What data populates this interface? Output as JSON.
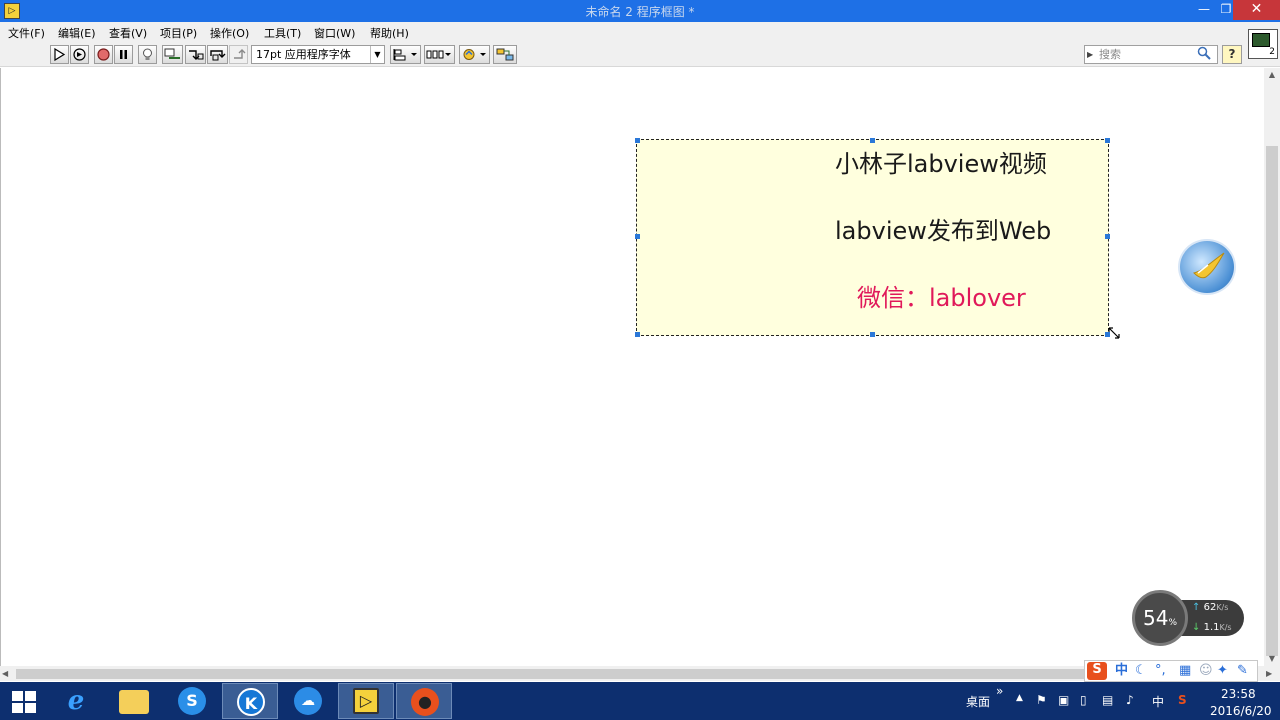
{
  "window": {
    "title": "未命名 2 程序框图 *",
    "app_icon_text": "▷",
    "min_glyph": "—",
    "max_glyph": "❐",
    "close_glyph": "✕"
  },
  "menu": [
    {
      "label": "文件(F)"
    },
    {
      "label": "编辑(E)"
    },
    {
      "label": "查看(V)"
    },
    {
      "label": "项目(P)"
    },
    {
      "label": "操作(O)"
    },
    {
      "label": "工具(T)"
    },
    {
      "label": "窗口(W)"
    },
    {
      "label": "帮助(H)"
    }
  ],
  "toolbar": {
    "font_value": "17pt 应用程序字体",
    "search_placeholder": "搜索",
    "help_glyph": "?",
    "vi_number": "2",
    "icons": [
      "run-arrow-icon",
      "run-continuous-icon",
      "abort-icon",
      "pause-icon",
      "highlight-execution-icon",
      "retain-wire-values-icon",
      "step-into-icon",
      "step-over-icon",
      "step-out-icon",
      "align-objects-icon",
      "distribute-objects-icon",
      "reorder-icon",
      "clean-up-diagram-icon"
    ]
  },
  "label": {
    "line1": "小林子labview视频",
    "line2": "labview发布到Web",
    "line3": "微信：lablover",
    "line3_color": "#e0195a"
  },
  "net_widget": {
    "percent": "54",
    "percent_unit": "%",
    "upload": "62",
    "upload_unit": "K/s",
    "download": "1.1",
    "download_unit": "K/s"
  },
  "ime": {
    "logo": "S",
    "mode": "中",
    "logo_color": "#e8501d"
  },
  "taskbar": {
    "apps": [
      "start",
      "internet-explorer",
      "file-explorer",
      "sogou-browser",
      "kugou",
      "baidu-netdisk",
      "labview",
      "recorder"
    ],
    "desktop_label": "桌面",
    "overflow": "»",
    "lang": "中",
    "time": "23:58",
    "date": "2016/6/20"
  }
}
